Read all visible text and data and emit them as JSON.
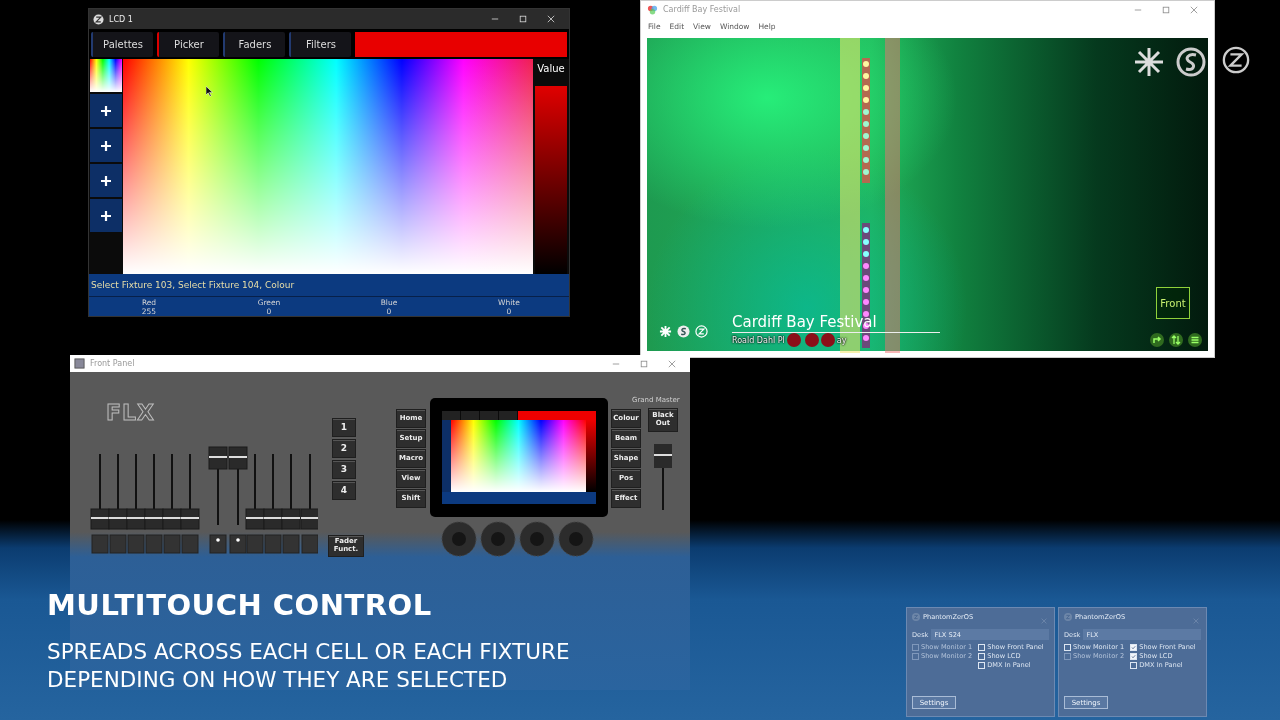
{
  "lcd_window": {
    "title": "LCD 1",
    "tabs": [
      {
        "label": "Palettes",
        "selected": false
      },
      {
        "label": "Picker",
        "selected": true
      },
      {
        "label": "Faders",
        "selected": false
      },
      {
        "label": "Filters",
        "selected": false
      }
    ],
    "value_label": "Value",
    "value_slider": {
      "level": 1
    },
    "command_line": "Select Fixture 103, Select Fixture 104, Colour",
    "channels": [
      {
        "name": "Red",
        "value": "255"
      },
      {
        "name": "Green",
        "value": "0"
      },
      {
        "name": "Blue",
        "value": "0"
      },
      {
        "name": "White",
        "value": "0"
      }
    ]
  },
  "visualizer_window": {
    "title": "Cardiff Bay Festival",
    "menu": [
      "File",
      "Edit",
      "View",
      "Window",
      "Help"
    ],
    "scene_title": "Cardiff Bay Festival",
    "scene_subtitle_parts": [
      "Roald Dahl Pl",
      "ay"
    ],
    "view_button": "Front"
  },
  "front_panel_window": {
    "title": "Front Panel",
    "logo": "FLX",
    "playback_keys": [
      "1",
      "2",
      "3",
      "4"
    ],
    "fader_function_key": "Fader Funct.",
    "left_keys": [
      "Home",
      "Setup",
      "Macro",
      "View",
      "Shift"
    ],
    "right_keys": [
      "Colour",
      "Beam",
      "Shape",
      "Pos",
      "Effect"
    ],
    "grand_master_label": "Grand Master",
    "blackout_key": "Black Out"
  },
  "caption": {
    "heading": "MULTITOUCH CONTROL",
    "lines": [
      "SPREADS ACROSS EACH CELL OR EACH FIXTURE",
      "DEPENDING ON HOW THEY ARE SELECTED"
    ]
  },
  "dialogs": [
    {
      "title": "PhantomZerOS",
      "desk_label": "Desk",
      "desk_value": "FLX S24",
      "left_options": [
        {
          "label": "Show Monitor 1",
          "checked": false,
          "disabled": true
        },
        {
          "label": "Show Monitor 2",
          "checked": false,
          "disabled": true
        }
      ],
      "right_options": [
        {
          "label": "Show Front Panel",
          "checked": false,
          "disabled": false
        },
        {
          "label": "Show LCD",
          "checked": false,
          "disabled": false
        },
        {
          "label": "DMX In Panel",
          "checked": false,
          "disabled": false
        }
      ],
      "button": "Settings"
    },
    {
      "title": "PhantomZerOS",
      "desk_label": "Desk",
      "desk_value": "FLX",
      "left_options": [
        {
          "label": "Show Monitor 1",
          "checked": false,
          "disabled": false
        },
        {
          "label": "Show Monitor 2",
          "checked": false,
          "disabled": true
        }
      ],
      "right_options": [
        {
          "label": "Show Front Panel",
          "checked": true,
          "disabled": false
        },
        {
          "label": "Show LCD",
          "checked": true,
          "disabled": false
        },
        {
          "label": "DMX In Panel",
          "checked": false,
          "disabled": false
        }
      ],
      "button": "Settings"
    }
  ]
}
